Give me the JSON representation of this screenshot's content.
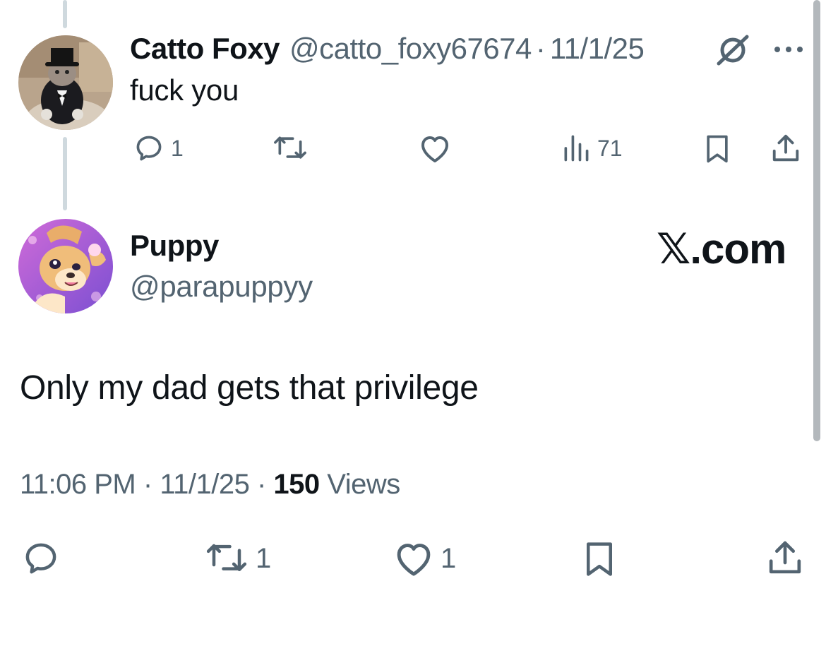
{
  "parent_tweet": {
    "display_name": "Catto Foxy",
    "handle": "@catto_foxy67674",
    "separator": "·",
    "date": "11/1/25",
    "text": "fuck you",
    "actions": {
      "reply_count": "1",
      "repost_count": "",
      "like_count": "",
      "views_count": "71"
    }
  },
  "main_tweet": {
    "display_name": "Puppy",
    "handle": "@parapuppyy",
    "text": "Only my dad gets that privilege",
    "time": "11:06 PM",
    "separator": "·",
    "date": "11/1/25",
    "views_count": "150",
    "views_label": "Views",
    "actions": {
      "reply_count": "",
      "repost_count": "1",
      "like_count": "1"
    }
  },
  "watermark": "𝕏.com",
  "colors": {
    "text_primary": "#0f1419",
    "text_secondary": "#536471",
    "thread_line": "#cfd9de",
    "background": "#ffffff"
  },
  "icons": [
    "grok-icon",
    "more-icon",
    "reply-icon",
    "repost-icon",
    "like-icon",
    "views-icon",
    "bookmark-icon",
    "share-icon"
  ]
}
